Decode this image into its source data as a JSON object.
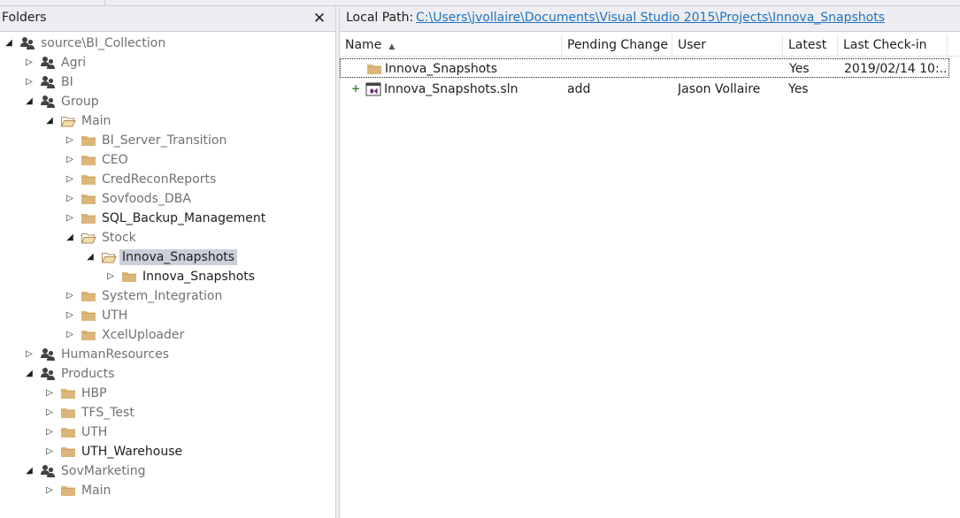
{
  "folders_panel": {
    "title": "Folders",
    "close_glyph": "✕",
    "tree": [
      {
        "label": "source\\BI_Collection",
        "icon": "team-project-icon",
        "expander": "expanded",
        "level": 0
      },
      {
        "label": "Agri",
        "icon": "team-project-icon",
        "expander": "collapsed",
        "level": 1
      },
      {
        "label": "BI",
        "icon": "team-project-icon",
        "expander": "collapsed",
        "level": 1
      },
      {
        "label": "Group",
        "icon": "team-project-icon",
        "expander": "expanded",
        "level": 1
      },
      {
        "label": "Main",
        "icon": "folder-open-icon",
        "expander": "expanded",
        "level": 2
      },
      {
        "label": "BI_Server_Transition",
        "icon": "folder-icon",
        "expander": "collapsed",
        "level": 3
      },
      {
        "label": "CEO",
        "icon": "folder-icon",
        "expander": "collapsed",
        "level": 3
      },
      {
        "label": "CredReconReports",
        "icon": "folder-icon",
        "expander": "collapsed",
        "level": 3
      },
      {
        "label": "Sovfoods_DBA",
        "icon": "folder-icon",
        "expander": "collapsed",
        "level": 3
      },
      {
        "label": "SQL_Backup_Management",
        "icon": "folder-icon",
        "expander": "collapsed",
        "level": 3,
        "dark": true
      },
      {
        "label": "Stock",
        "icon": "folder-open-icon",
        "expander": "expanded",
        "level": 3
      },
      {
        "label": "Innova_Snapshots",
        "icon": "folder-open-icon",
        "expander": "expanded",
        "level": 4,
        "selected": true
      },
      {
        "label": "Innova_Snapshots",
        "icon": "folder-icon",
        "expander": "collapsed",
        "level": 5,
        "dark": true
      },
      {
        "label": "System_Integration",
        "icon": "folder-icon",
        "expander": "collapsed",
        "level": 3
      },
      {
        "label": "UTH",
        "icon": "folder-icon",
        "expander": "collapsed",
        "level": 3
      },
      {
        "label": "XcelUploader",
        "icon": "folder-icon",
        "expander": "collapsed",
        "level": 3
      },
      {
        "label": "HumanResources",
        "icon": "team-project-icon",
        "expander": "collapsed",
        "level": 1
      },
      {
        "label": "Products",
        "icon": "team-project-icon",
        "expander": "expanded",
        "level": 1
      },
      {
        "label": "HBP",
        "icon": "folder-icon",
        "expander": "collapsed",
        "level": 2
      },
      {
        "label": "TFS_Test",
        "icon": "folder-icon",
        "expander": "collapsed",
        "level": 2
      },
      {
        "label": "UTH",
        "icon": "folder-icon",
        "expander": "collapsed",
        "level": 2
      },
      {
        "label": "UTH_Warehouse",
        "icon": "folder-icon",
        "expander": "collapsed",
        "level": 2,
        "dark": true
      },
      {
        "label": "SovMarketing",
        "icon": "team-project-icon",
        "expander": "expanded",
        "level": 1
      },
      {
        "label": "Main",
        "icon": "folder-icon",
        "expander": "collapsed",
        "level": 2
      }
    ]
  },
  "details_panel": {
    "local_path_label": "Local Path:",
    "local_path": "C:\\Users\\jvollaire\\Documents\\Visual Studio 2015\\Projects\\Innova_Snapshots",
    "columns": [
      "Name",
      "Pending Change",
      "User",
      "Latest",
      "Last Check-in"
    ],
    "sorted_column": "Name",
    "sort_glyph": "▲",
    "rows": [
      {
        "icon": "folder-icon",
        "name": "Innova_Snapshots",
        "pending_change": "",
        "user": "",
        "latest": "Yes",
        "last_checkin": "2019/02/14 10:...",
        "focused": true,
        "pending_add": false
      },
      {
        "icon": "solution-file-icon",
        "name": "Innova_Snapshots.sln",
        "pending_change": "add",
        "user": "Jason Vollaire",
        "latest": "Yes",
        "last_checkin": "",
        "focused": false,
        "pending_add": true,
        "add_glyph": "+"
      }
    ]
  },
  "colors": {
    "folder": "#dcb67a",
    "selection": "#cccedb",
    "link": "#1e73c3",
    "pending_add": "#388a34",
    "vs_purple": "#68217a"
  }
}
